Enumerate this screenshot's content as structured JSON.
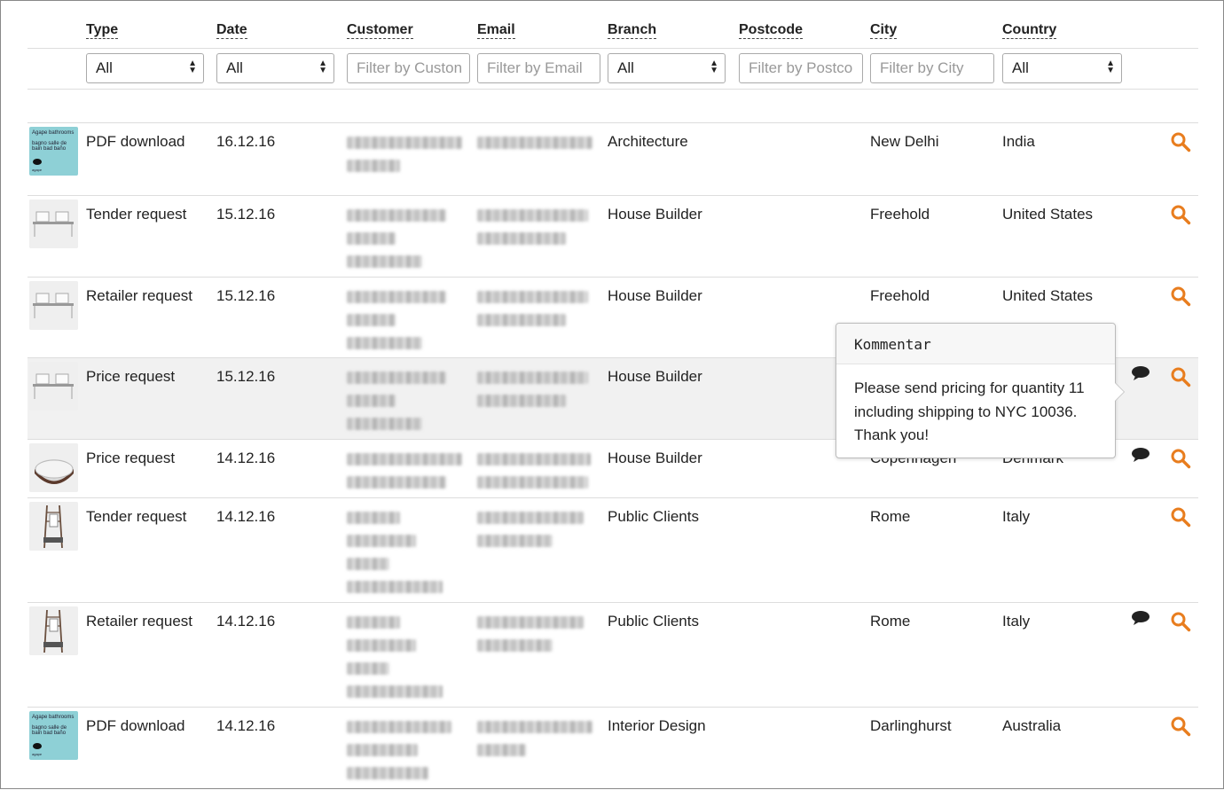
{
  "accent_color": "#e87d1e",
  "columns": {
    "type": "Type",
    "date": "Date",
    "customer": "Customer",
    "email": "Email",
    "branch": "Branch",
    "postcode": "Postcode",
    "city": "City",
    "country": "Country"
  },
  "filters": {
    "type_value": "All",
    "date_value": "All",
    "customer_placeholder": "Filter by Custon",
    "email_placeholder": "Filter by Email",
    "branch_value": "All",
    "postcode_placeholder": "Filter by Postco",
    "city_placeholder": "Filter by City",
    "country_value": "All"
  },
  "rows": [
    {
      "type": "PDF download",
      "date": "16.12.16",
      "branch": "Architecture",
      "city": "New Delhi",
      "country": "India"
    },
    {
      "type": "Tender request",
      "date": "15.12.16",
      "branch": "House Builder",
      "city": "Freehold",
      "country": "United States"
    },
    {
      "type": "Retailer request",
      "date": "15.12.16",
      "branch": "House Builder",
      "city": "Freehold",
      "country": "United States"
    },
    {
      "type": "Price request",
      "date": "15.12.16",
      "branch": "House Builder",
      "city": "",
      "country": ""
    },
    {
      "type": "Price request",
      "date": "14.12.16",
      "branch": "House Builder",
      "city": "Copenhagen",
      "country": "Denmark"
    },
    {
      "type": "Tender request",
      "date": "14.12.16",
      "branch": "Public Clients",
      "city": "Rome",
      "country": "Italy"
    },
    {
      "type": "Retailer request",
      "date": "14.12.16",
      "branch": "Public Clients",
      "city": "Rome",
      "country": "Italy"
    },
    {
      "type": "PDF download",
      "date": "14.12.16",
      "branch": "Interior Design",
      "city": "Darlinghurst",
      "country": "Australia"
    }
  ],
  "brochure_thumb": {
    "title": "Agape bathrooms",
    "subtitle": "bagno salle de bain bad baño",
    "logo": "agape"
  },
  "tooltip": {
    "title": "Kommentar",
    "line1": "Please send pricing for quantity 11",
    "line2": "including shipping to NYC 10036.",
    "line3": "Thank you!"
  }
}
